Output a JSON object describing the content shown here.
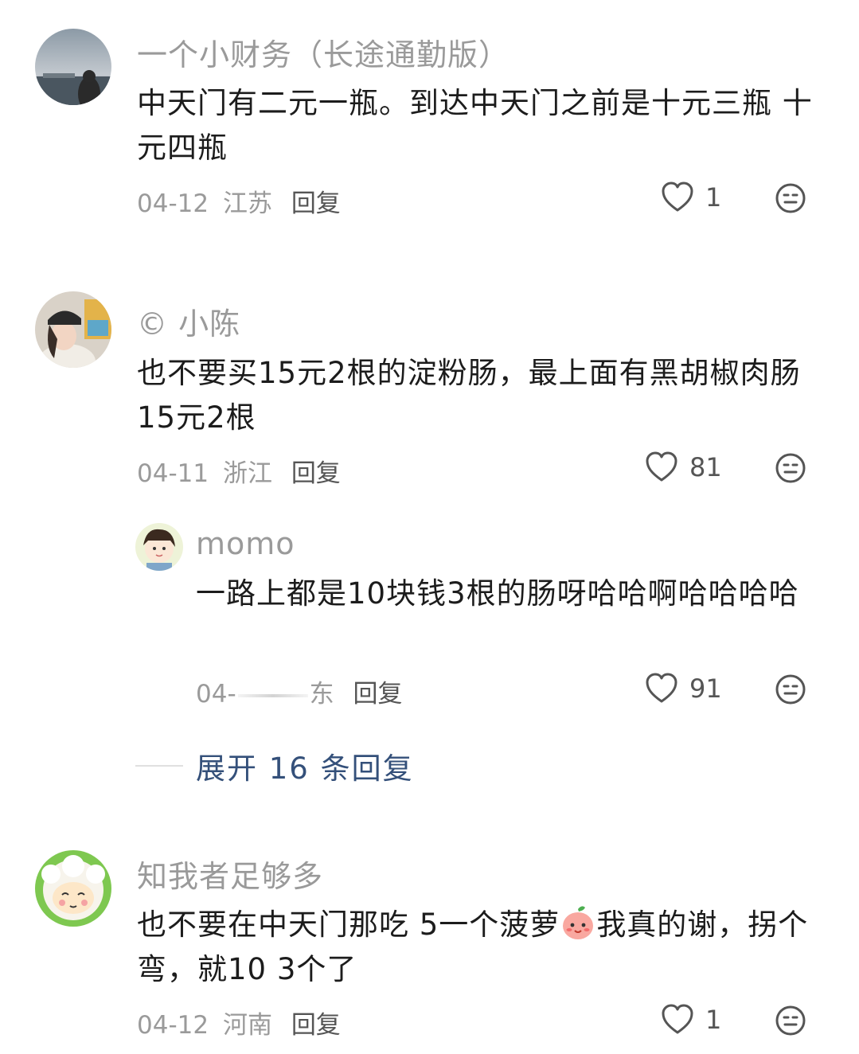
{
  "comments": [
    {
      "username": "一个小财务（长途通勤版）",
      "text": "中天门有二元一瓶。到达中天门之前是十元三瓶 十元四瓶",
      "date": "04-12",
      "location": "江苏",
      "reply_label": "回复",
      "likes": "1"
    },
    {
      "username": "© 小陈",
      "text": "也不要买15元2根的淀粉肠，最上面有黑胡椒肉肠15元2根",
      "date": "04-11",
      "location": "浙江",
      "reply_label": "回复",
      "likes": "81",
      "replies": [
        {
          "username": "momo",
          "text": "一路上都是10块钱3根的肠呀哈哈啊哈哈哈哈",
          "date": "04-",
          "location": "东",
          "reply_label": "回复",
          "likes": "91"
        }
      ],
      "expand_label": "展开 16 条回复"
    },
    {
      "username": "知我者足够多",
      "text": "也不要在中天门那吃 5一个菠萝",
      "text_after_emoji": "我真的谢，拐个弯，就10 3个了",
      "date": "04-12",
      "location": "河南",
      "reply_label": "回复",
      "likes": "1"
    }
  ],
  "icons": {
    "like": "heart-outline-icon",
    "dislike": "neutral-face-icon",
    "emoji": "peach-emoji-icon"
  },
  "colors": {
    "username": "#9a9a9a",
    "text": "#1c1c1c",
    "expand": "#34507a"
  }
}
